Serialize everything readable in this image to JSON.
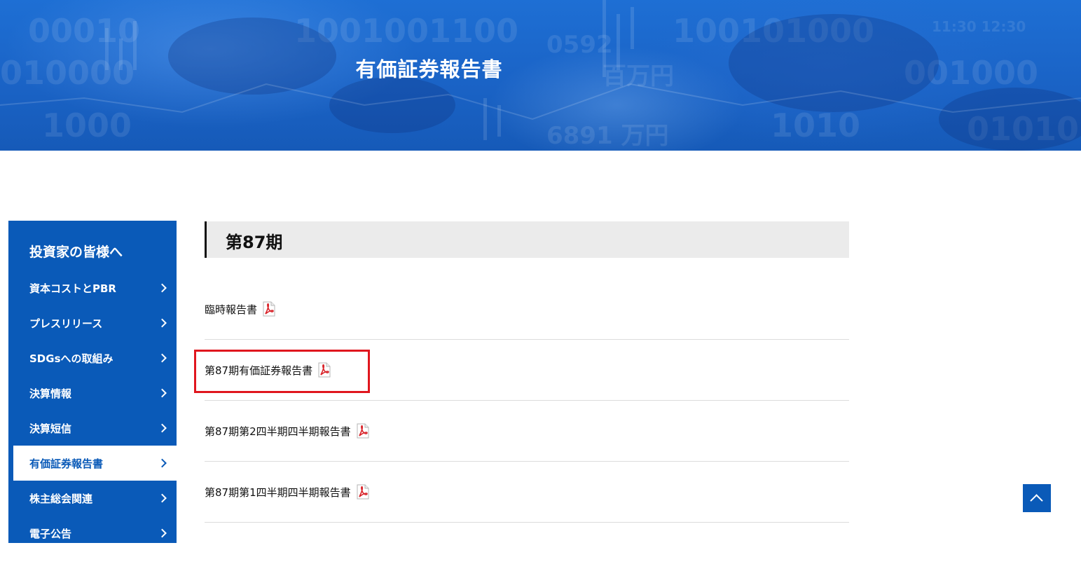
{
  "hero": {
    "title": "有価証券報告書"
  },
  "sidebar": {
    "title": "投資家の皆様へ",
    "items": [
      {
        "label": "資本コストとPBR",
        "active": false
      },
      {
        "label": "プレスリリース",
        "active": false
      },
      {
        "label": "SDGsへの取組み",
        "active": false
      },
      {
        "label": "決算情報",
        "active": false
      },
      {
        "label": "決算短信",
        "active": false
      },
      {
        "label": "有価証券報告書",
        "active": true
      },
      {
        "label": "株主総会関連",
        "active": false
      },
      {
        "label": "電子公告",
        "active": false
      }
    ]
  },
  "main": {
    "section_title": "第87期",
    "documents": [
      {
        "label": "臨時報告書"
      },
      {
        "label": "第87期有価証券報告書"
      },
      {
        "label": "第87期第2四半期四半期報告書"
      },
      {
        "label": "第87期第1四半期四半期報告書"
      }
    ]
  },
  "colors": {
    "brand": "#0a5ab8",
    "highlight": "#e0161e",
    "pdf": "#d9262c"
  },
  "icons": {
    "pdf": "pdf-icon",
    "chevron": "chevron-right-icon",
    "back_to_top": "chevron-up-icon"
  }
}
